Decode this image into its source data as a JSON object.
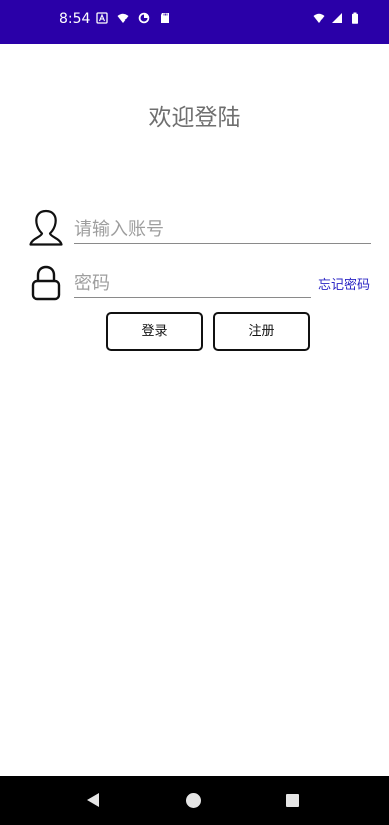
{
  "status_bar": {
    "time": "8:54",
    "left_icons": [
      "keyboard-icon",
      "wifi-question-icon",
      "data-saver-icon",
      "sd-card-icon"
    ],
    "right_icons": [
      "wifi-icon",
      "signal-icon",
      "battery-icon"
    ],
    "color": "#2a00a8"
  },
  "login": {
    "title": "欢迎登陆",
    "account_placeholder": "请输入账号",
    "password_placeholder": "密码",
    "forgot_password": "忘记密码",
    "login_button": "登录",
    "register_button": "注册",
    "link_color": "#2a24c4"
  },
  "nav_bar": {
    "buttons": [
      "back-icon",
      "home-icon",
      "recents-icon"
    ]
  }
}
